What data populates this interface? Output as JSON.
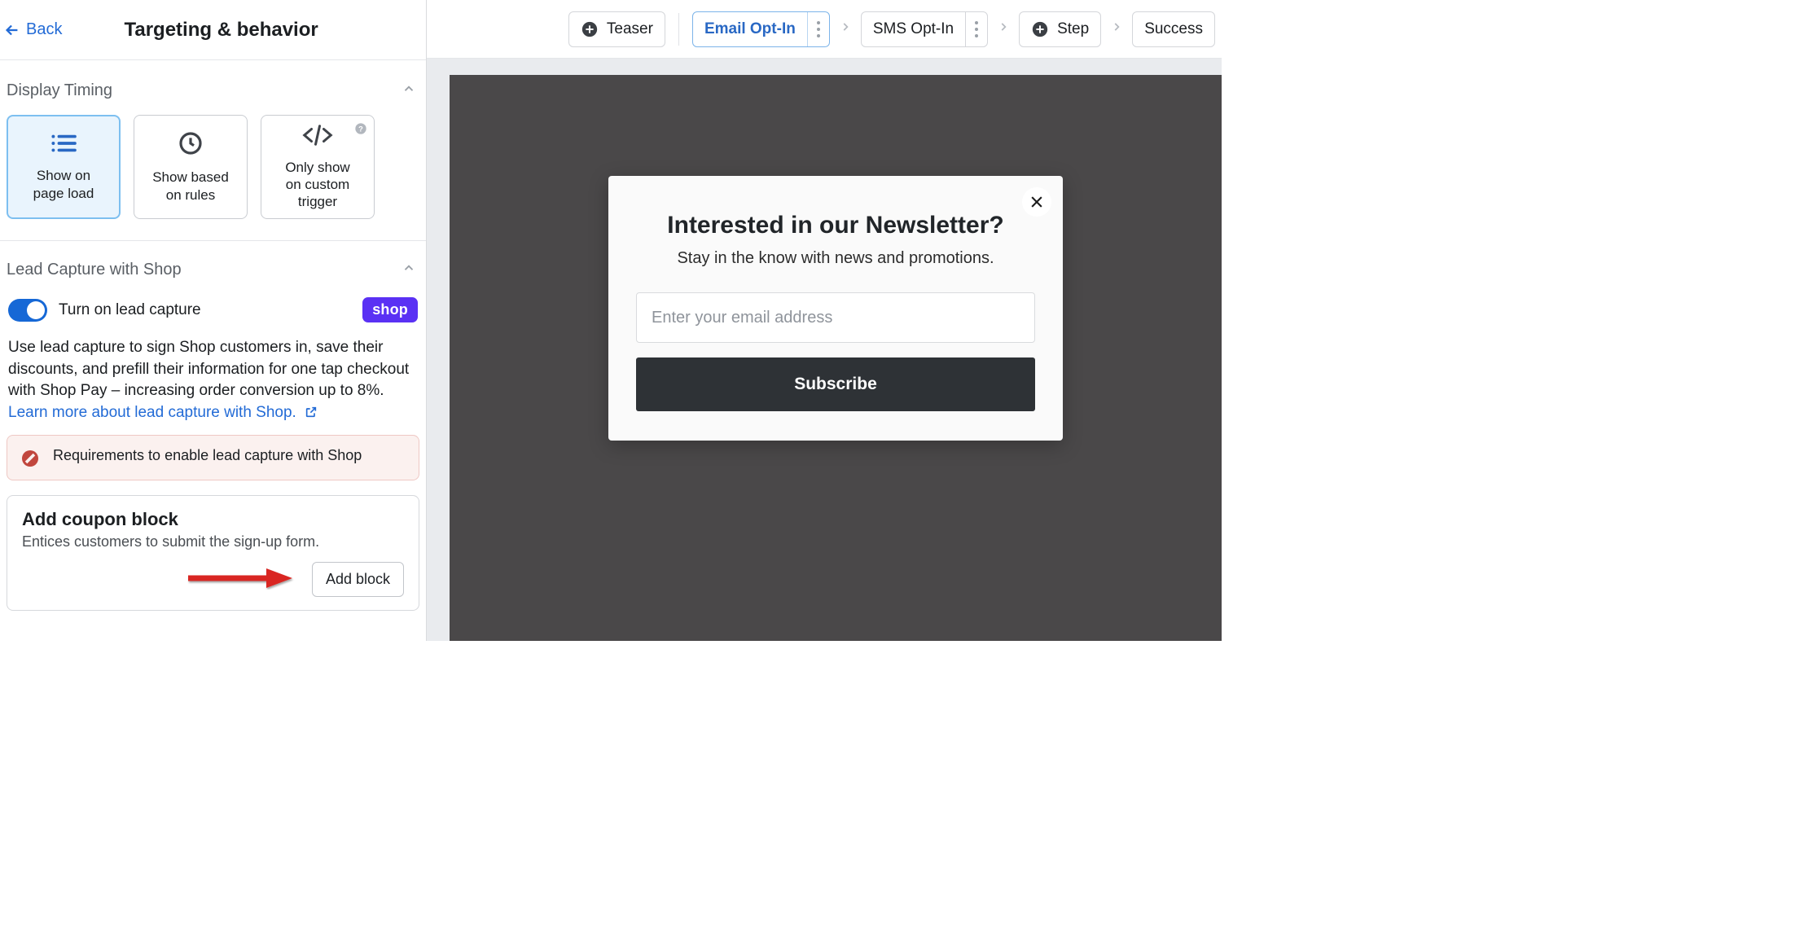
{
  "header": {
    "back_label": "Back",
    "title": "Targeting & behavior"
  },
  "display_timing": {
    "title": "Display Timing",
    "options": {
      "page_load": "Show on\npage load",
      "rules": "Show based\non rules",
      "custom": "Only show\non custom\ntrigger"
    }
  },
  "lead_capture": {
    "title": "Lead Capture with Shop",
    "toggle_label": "Turn on lead capture",
    "badge": "shop",
    "desc": "Use lead capture to sign Shop customers in, save their discounts, and prefill their information for one tap checkout with Shop Pay – increasing order conversion up to 8%.",
    "learn_more": "Learn more about lead capture with Shop.",
    "warning": "Requirements to enable lead capture with Shop"
  },
  "coupon_block": {
    "title": "Add coupon block",
    "desc": "Entices customers to submit the sign-up form.",
    "button": "Add block"
  },
  "steps": {
    "teaser": "Teaser",
    "email_optin": "Email Opt-In",
    "sms_optin": "SMS Opt-In",
    "step": "Step",
    "success": "Success"
  },
  "popup": {
    "title": "Interested in our Newsletter?",
    "subtitle": "Stay in the know with news and promotions.",
    "placeholder": "Enter your email address",
    "button": "Subscribe"
  }
}
